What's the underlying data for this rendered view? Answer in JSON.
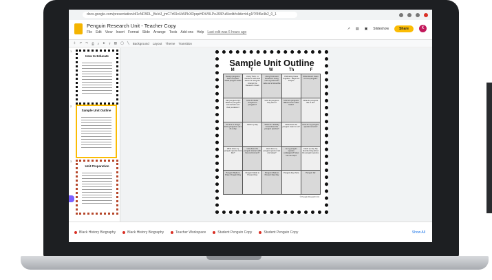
{
  "browser": {
    "url": "docs.google.com/presentation/d/1cNFBDL_BxIdJ_jmC7rK9vUk5PbXRpqeHDtV8LPoJ83Pu8/edit#slide=id.g1f7f3f6e4b2_0_1"
  },
  "doc": {
    "title": "Penguin Research Unit - Teacher Copy"
  },
  "menu": [
    "File",
    "Edit",
    "View",
    "Insert",
    "Format",
    "Slide",
    "Arrange",
    "Tools",
    "Add-ons",
    "Help",
    "Last edit was 6 hours ago"
  ],
  "toolbar": {
    "background": "Background",
    "layout": "Layout",
    "theme": "Theme",
    "transition": "Transition"
  },
  "header": {
    "slideshow": "Slideshow",
    "share": "Share",
    "avatar": "K"
  },
  "thumbnails": [
    {
      "num": "1",
      "title": "How to Educate"
    },
    {
      "num": "2",
      "title": "Sample Unit Outline"
    },
    {
      "num": "3",
      "title": "Unit Preparation"
    }
  ],
  "slide": {
    "title": "Sample Unit Outline",
    "days": [
      "M",
      "T",
      "W",
      "Th",
      "F"
    ],
    "rows": [
      [
        "Design penguins. Then compare. Dead penguin video",
        "Using Tools - a hands-on with kids lesson & using the internet the Research Vocab",
        "Using Tools and Research: Hang onto a great brain cells and a Smoothie",
        "Pollinating Ideas Together - Begin the Project",
        "What does it mean to be a penguin?"
      ],
      [
        "Can penguins fly? What do penguins eat and who are their predators?",
        "How do ducks compare to penguins?",
        "How do penguins stay warm?",
        "How are penguins different from other birds?",
        "What do penguins like to do?"
      ],
      [
        "It's time to bring a kid to penguins. Let's do a day",
        "Catch up day",
        "What do I already know about the penguin species?",
        "What does the penguin mean to us?",
        "How do my penguin species survive?"
      ],
      [
        "What does my penguin species look like?",
        "How does the penguin interact with the environment?",
        "How does my penguin species rest and sleep?",
        "Is my penguin species endangered? How can we help?",
        "Catch up day. My favorite thing about the penguin species."
      ],
      [
        "Penguin Made to Draw, Penguin Day",
        "Penguin Made to Present Day",
        "Penguin Made to Present Idea Day",
        "Penguin day share",
        "Penguin fair"
      ]
    ],
    "footer": "© Penguin Research Unit"
  },
  "tabs": [
    "Black History Biography",
    "Black History Biography",
    "Teacher Workspace",
    "Student Penguin Copy",
    "Student Penguin Copy"
  ],
  "show_all": "Show All"
}
